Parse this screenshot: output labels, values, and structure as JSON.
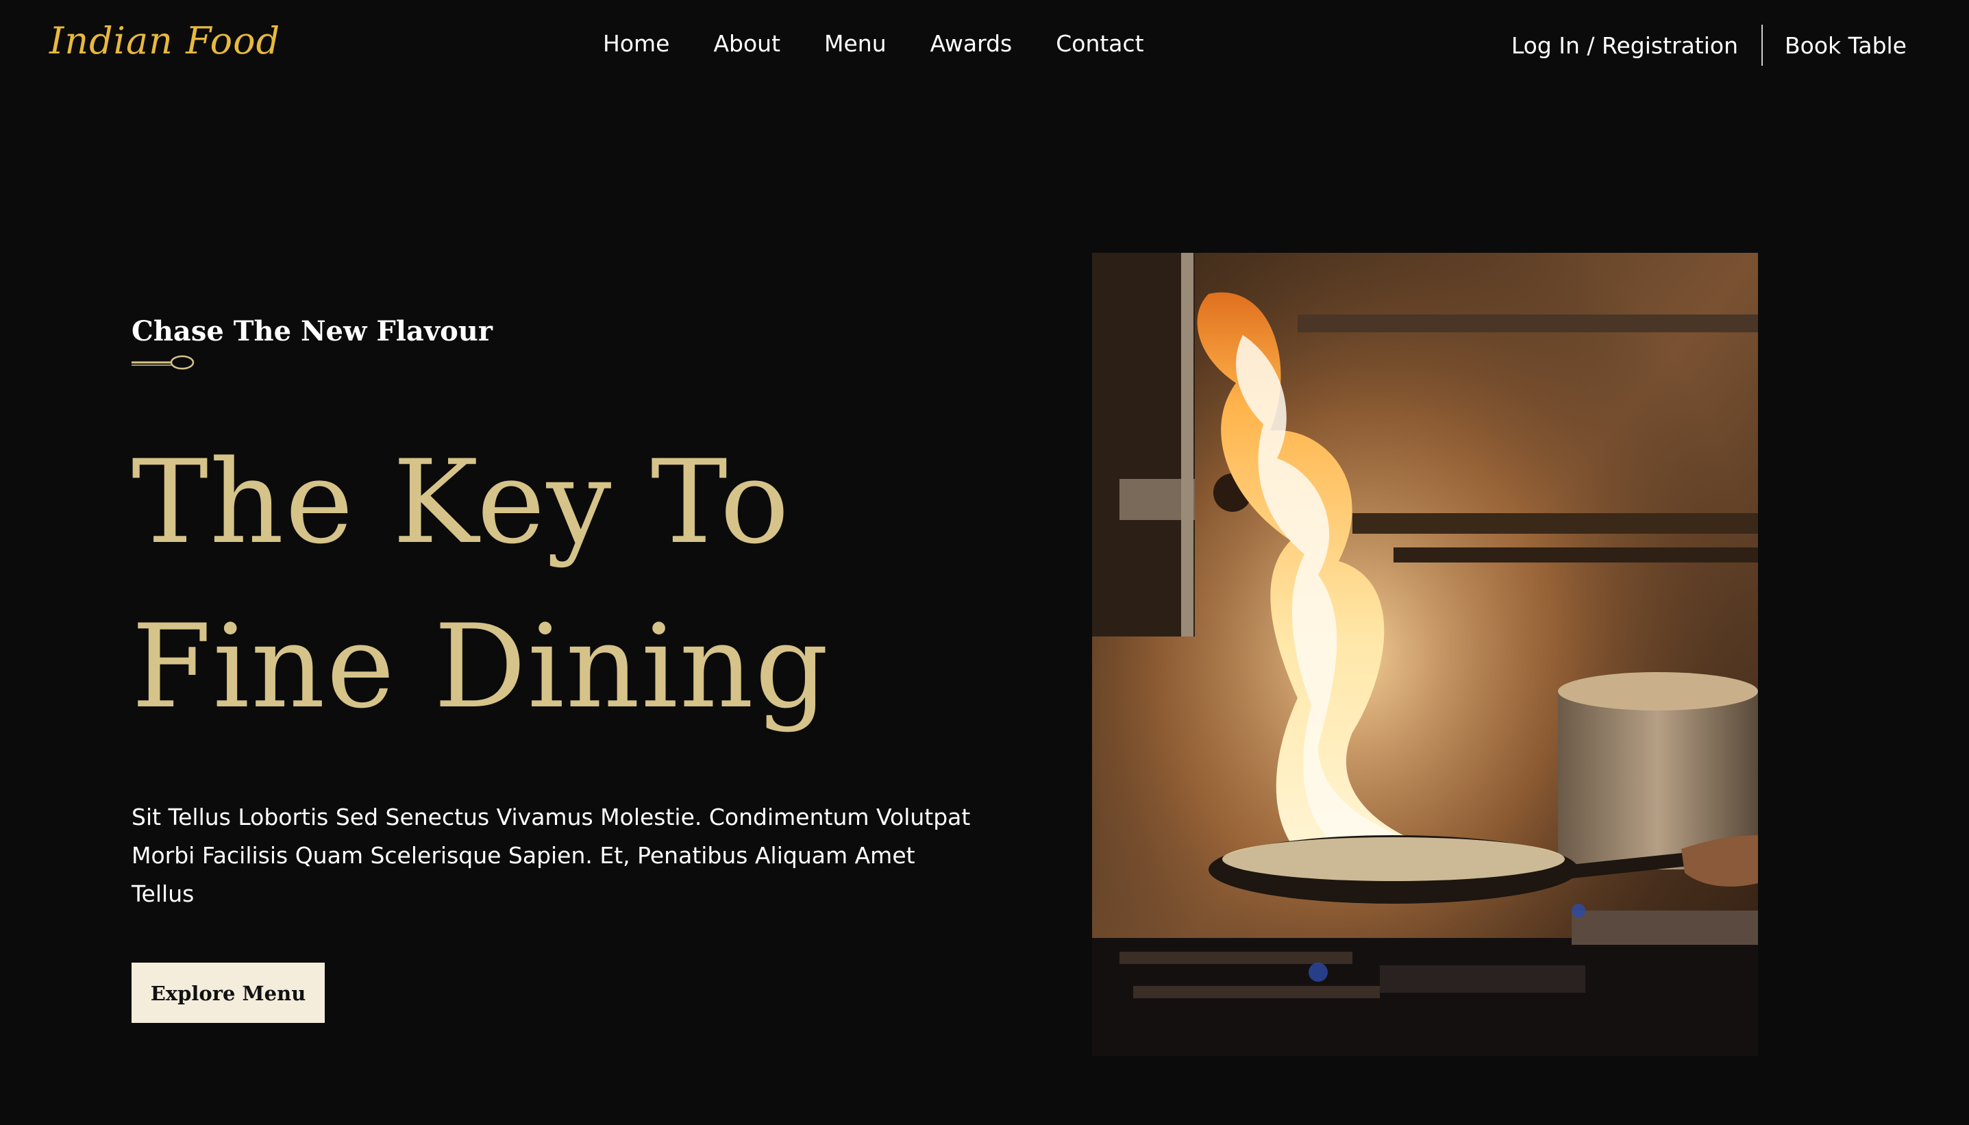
{
  "header": {
    "logo": "Indian Food",
    "nav": [
      {
        "label": "Home"
      },
      {
        "label": "About"
      },
      {
        "label": "Menu"
      },
      {
        "label": "Awards"
      },
      {
        "label": "Contact"
      }
    ],
    "login_label": "Log In / Registration",
    "book_label": "Book Table"
  },
  "hero": {
    "eyebrow": "Chase The New Flavour",
    "divider_icon": "spoon-icon",
    "headline_line1": "The Key To",
    "headline_line2": "Fine Dining",
    "description": "Sit Tellus Lobortis Sed Senectus Vivamus Molestie. Condimentum Volutpat Morbi Facilisis Quam Scelerisque Sapien. Et, Penatibus Aliquam Amet Tellus",
    "cta_label": "Explore Menu",
    "image_subject": "chef flambéing a pan over a stove"
  },
  "colors": {
    "background": "#0b0b0b",
    "logo": "#e8b93e",
    "headline": "#d6c389",
    "button_bg": "#f4eddc",
    "text": "#ffffff"
  }
}
